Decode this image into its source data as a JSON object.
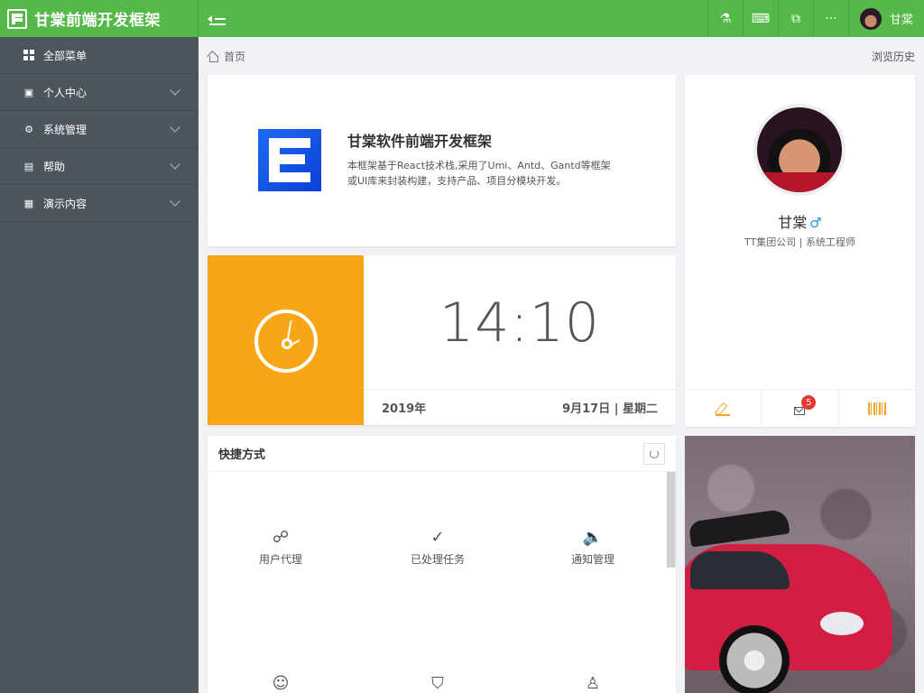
{
  "app": {
    "title": "甘棠前端开发框架"
  },
  "topbar": {
    "tools": [
      {
        "name": "flask-icon",
        "glyph": "⚗"
      },
      {
        "name": "keyboard-icon",
        "glyph": "⌨"
      },
      {
        "name": "equalizer-icon",
        "glyph": "⧉"
      },
      {
        "name": "more-icon",
        "glyph": "···"
      }
    ],
    "user_name": "甘棠"
  },
  "sidebar": {
    "items": [
      {
        "label": "全部菜单",
        "icon": "grid-icon",
        "expandable": false
      },
      {
        "label": "个人中心",
        "icon": "contact-icon",
        "glyph": "▣",
        "expandable": true
      },
      {
        "label": "系统管理",
        "icon": "gear-icon",
        "glyph": "⚙",
        "expandable": true
      },
      {
        "label": "帮助",
        "icon": "document-icon",
        "glyph": "▤",
        "expandable": true
      },
      {
        "label": "演示内容",
        "icon": "demo-icon",
        "glyph": "▦",
        "expandable": true
      }
    ]
  },
  "breadcrumb": {
    "home": "首页",
    "history": "浏览历史"
  },
  "intro": {
    "title": "甘棠软件前端开发框架",
    "description": "本框架基于React技术栈,采用了Umi、Antd、Gantd等框架或UI库来封装构建，支持产品、项目分模块开发。"
  },
  "clock": {
    "time": "14:10",
    "year": "2019年",
    "date": "9月17日 | 星期二",
    "color": "#f8a616"
  },
  "profile": {
    "name": "甘棠",
    "gender_symbol": "♂",
    "org": "TT集团公司 | 系统工程师",
    "mail_badge": "5",
    "actions": [
      "edit-icon",
      "mail-icon",
      "barcode-icon"
    ]
  },
  "shortcuts": {
    "title": "快捷方式",
    "items": [
      {
        "label": "用户代理",
        "icon": "agent-icon",
        "glyph": "☍"
      },
      {
        "label": "已处理任务",
        "icon": "task-done-icon",
        "glyph": "✓"
      },
      {
        "label": "通知管理",
        "icon": "speaker-icon",
        "glyph": "🔈"
      },
      {
        "label": "",
        "icon": "users-icon",
        "glyph": "☺"
      },
      {
        "label": "",
        "icon": "shield-user-icon",
        "glyph": "⛉"
      },
      {
        "label": "",
        "icon": "user-minus-icon",
        "glyph": "♙"
      }
    ]
  },
  "colors": {
    "header_green": "#55b949",
    "sidebar_gray": "#4d555d",
    "accent_orange": "#f5a623",
    "badge_red": "#e53935"
  }
}
